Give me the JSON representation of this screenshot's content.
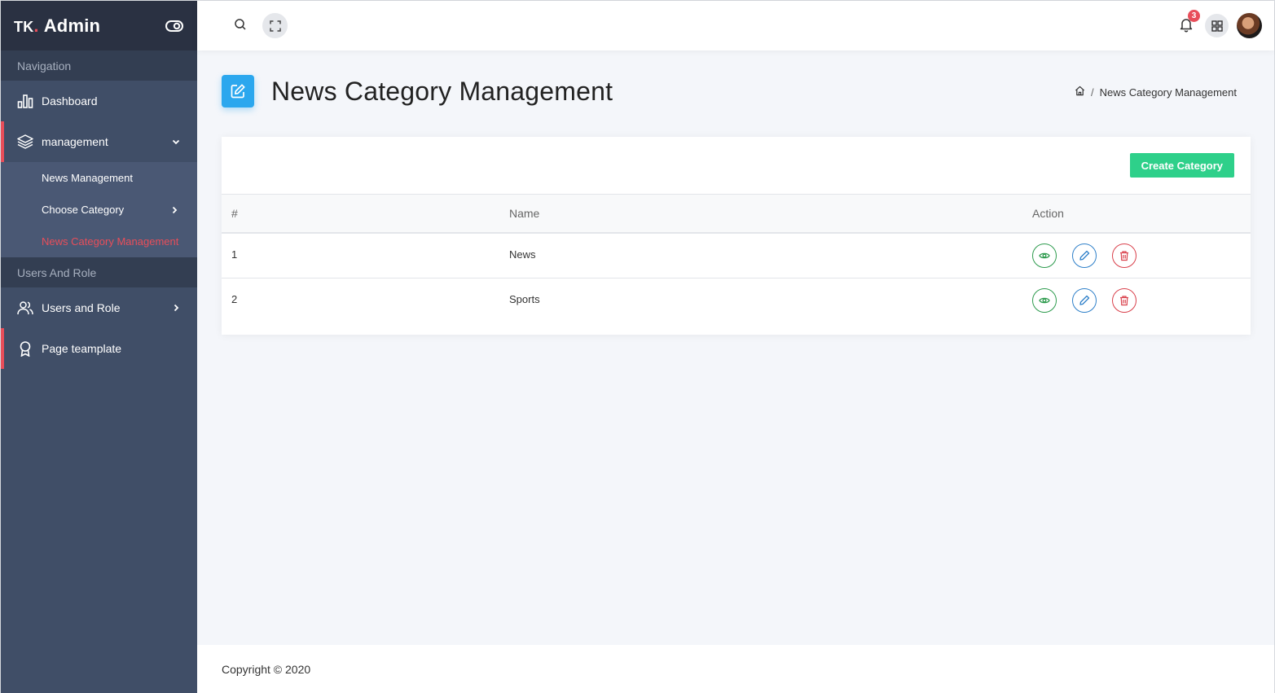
{
  "brand": {
    "prefix": "TK",
    "dot": ".",
    "name": "Admin"
  },
  "sidebar": {
    "captions": [
      "Navigation",
      "Users And Role"
    ],
    "items": [
      {
        "label": "Dashboard",
        "icon": "bar-chart-icon"
      },
      {
        "label": "management",
        "icon": "layers-icon"
      },
      {
        "label": "Users and Role",
        "icon": "users-icon"
      },
      {
        "label": "Page teamplate",
        "icon": "award-icon"
      }
    ],
    "submenu": [
      {
        "label": "News Management"
      },
      {
        "label": "Choose Category"
      },
      {
        "label": "News Category Management"
      }
    ]
  },
  "topbar": {
    "notification_count": "3"
  },
  "page": {
    "title": "News Category Management",
    "breadcrumb": "News Category Management"
  },
  "card": {
    "create_label": "Create Category",
    "columns": [
      "#",
      "Name",
      "Action"
    ],
    "rows": [
      {
        "num": "1",
        "name": "News"
      },
      {
        "num": "2",
        "name": "Sports"
      }
    ]
  },
  "footer": {
    "text": "Copyright © 2020"
  },
  "colors": {
    "sidebar": "#404e67",
    "accent_red": "#e84e5a",
    "primary_blue": "#2ba7ee",
    "success_green": "#2ed08a"
  }
}
